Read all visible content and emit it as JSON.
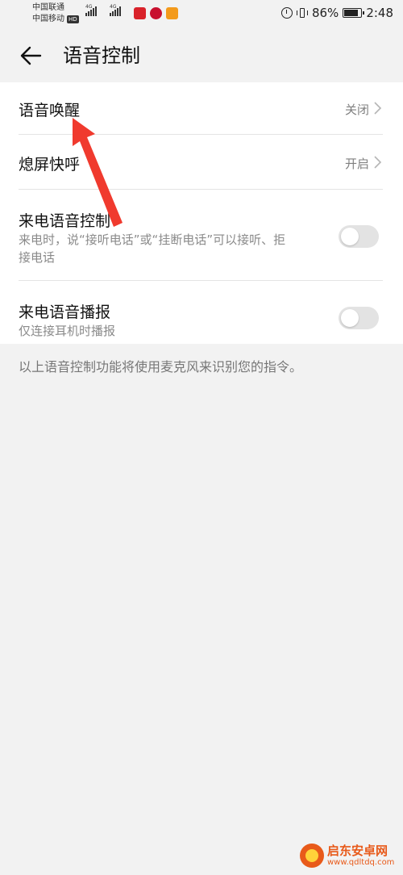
{
  "status_bar": {
    "carrier1": "中国联通",
    "carrier2": "中国移动",
    "hd_badge": "HD",
    "network1": "4G",
    "network2": "4G",
    "battery_percent": "86%",
    "battery_level": 0.86,
    "time": "2:48"
  },
  "header": {
    "title": "语音控制"
  },
  "settings": {
    "voice_wake": {
      "label": "语音唤醒",
      "value": "关闭"
    },
    "screen_off_call": {
      "label": "熄屏快呼",
      "value": "开启"
    },
    "incoming_voice_control": {
      "label": "来电语音控制",
      "desc": "来电时，说“接听电话”或“挂断电话”可以接听、拒接电话",
      "enabled": false
    },
    "incoming_voice_announce": {
      "label": "来电语音播报",
      "desc": "仅连接耳机时播报",
      "enabled": false
    }
  },
  "footer_note": "以上语音控制功能将使用麦克风来识别您的指令。",
  "watermark": {
    "name": "启东安卓网",
    "url": "www.qdltdq.com"
  },
  "colors": {
    "annotation_arrow": "#f03a2e",
    "toggle_off": "#e3e3e3",
    "watermark": "#e85a1a"
  }
}
